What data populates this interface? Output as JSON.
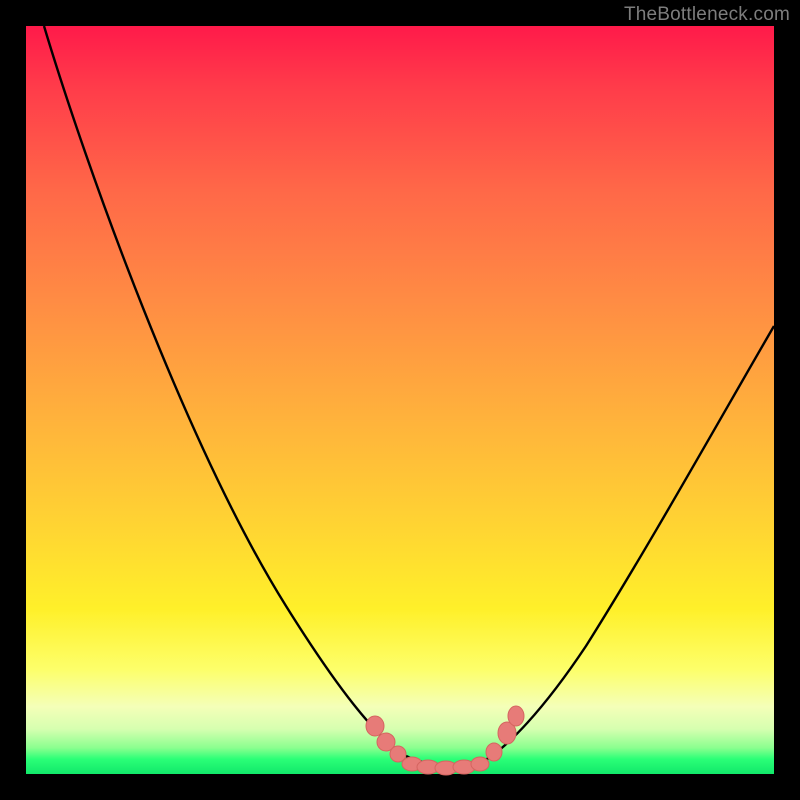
{
  "watermark": "TheBottleneck.com",
  "colors": {
    "frame": "#000000",
    "curve": "#000000",
    "marker_fill": "#e77b78",
    "marker_stroke": "#d56560"
  },
  "chart_data": {
    "type": "line",
    "title": "",
    "xlabel": "",
    "ylabel": "",
    "xlim": [
      0,
      100
    ],
    "ylim": [
      0,
      100
    ],
    "note": "V-shaped bottleneck curve. Y is bottleneck percent (0 = ideal at bottom trough). X is relative component performance. Values estimated from gradient position; no axis ticks shown.",
    "series": [
      {
        "name": "bottleneck-curve",
        "x": [
          2,
          6,
          10,
          14,
          18,
          22,
          26,
          30,
          34,
          38,
          42,
          46,
          48,
          50,
          52,
          54,
          56,
          58,
          60,
          64,
          68,
          72,
          76,
          80,
          84,
          88,
          92,
          96,
          100
        ],
        "y": [
          100,
          93,
          86,
          79,
          72,
          64,
          56,
          48,
          40,
          32,
          23,
          13,
          8,
          3,
          1,
          0,
          0,
          0,
          1,
          5,
          11,
          18,
          25,
          32,
          38,
          44,
          50,
          55,
          60
        ]
      }
    ],
    "markers": {
      "name": "highlight-points",
      "x": [
        46,
        48,
        50,
        52,
        54,
        56,
        58,
        60,
        62,
        63
      ],
      "y": [
        10,
        5,
        2,
        1,
        0,
        0,
        0,
        1,
        4,
        8
      ]
    }
  }
}
